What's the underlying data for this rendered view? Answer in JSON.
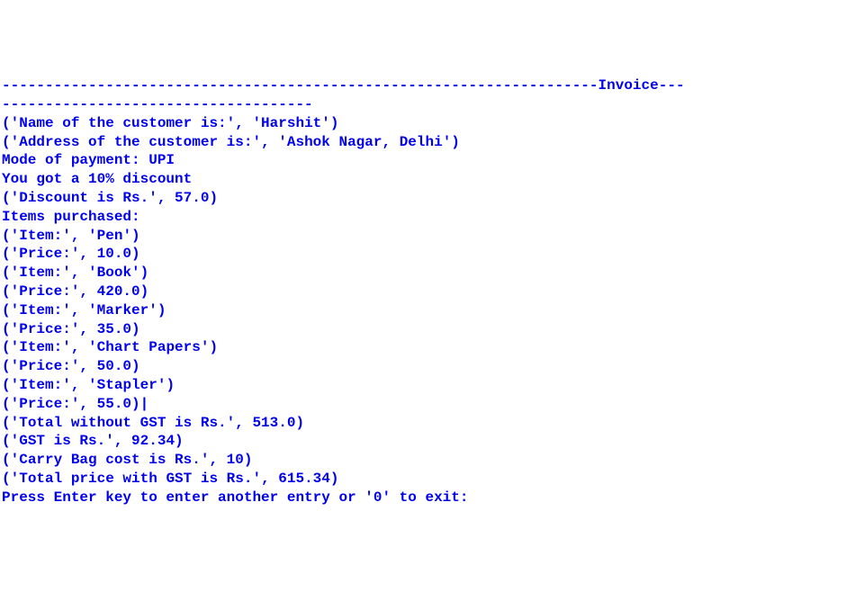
{
  "header": {
    "dashes_before": "---------------------------------------------------------------------",
    "title": "Invoice",
    "dashes_after": "---",
    "dashes_line2": "------------------------------------"
  },
  "customer": {
    "name_label": "'Name of the customer is:'",
    "name_value": "'Harshit'",
    "address_label": "'Address of the customer is:'",
    "address_value": "'Ashok Nagar, Delhi'"
  },
  "payment": {
    "mode_line": "Mode of payment: UPI",
    "discount_msg": "You got a 10% discount",
    "discount_label": "'Discount is Rs.'",
    "discount_value": "57.0"
  },
  "items_header": "Items purchased:",
  "items": [
    {
      "item_label": "'Item:'",
      "item_value": "'Pen'",
      "price_label": "'Price:'",
      "price_value": "10.0"
    },
    {
      "item_label": "'Item:'",
      "item_value": "'Book'",
      "price_label": "'Price:'",
      "price_value": "420.0"
    },
    {
      "item_label": "'Item:'",
      "item_value": "'Marker'",
      "price_label": "'Price:'",
      "price_value": "35.0"
    },
    {
      "item_label": "'Item:'",
      "item_value": "'Chart Papers'",
      "price_label": "'Price:'",
      "price_value": "50.0"
    },
    {
      "item_label": "'Item:'",
      "item_value": "'Stapler'",
      "price_label": "'Price:'",
      "price_value": "55.0"
    }
  ],
  "cursor": "|",
  "totals": {
    "subtotal_label": "'Total without GST is Rs.'",
    "subtotal_value": "513.0",
    "gst_label": "'GST is Rs.'",
    "gst_value": "92.34",
    "bag_label": "'Carry Bag cost is Rs.'",
    "bag_value": "10",
    "total_label": "'Total price with GST is Rs.'",
    "total_value": "615.34"
  },
  "prompt": "Press Enter key to enter another entry or '0' to exit:"
}
